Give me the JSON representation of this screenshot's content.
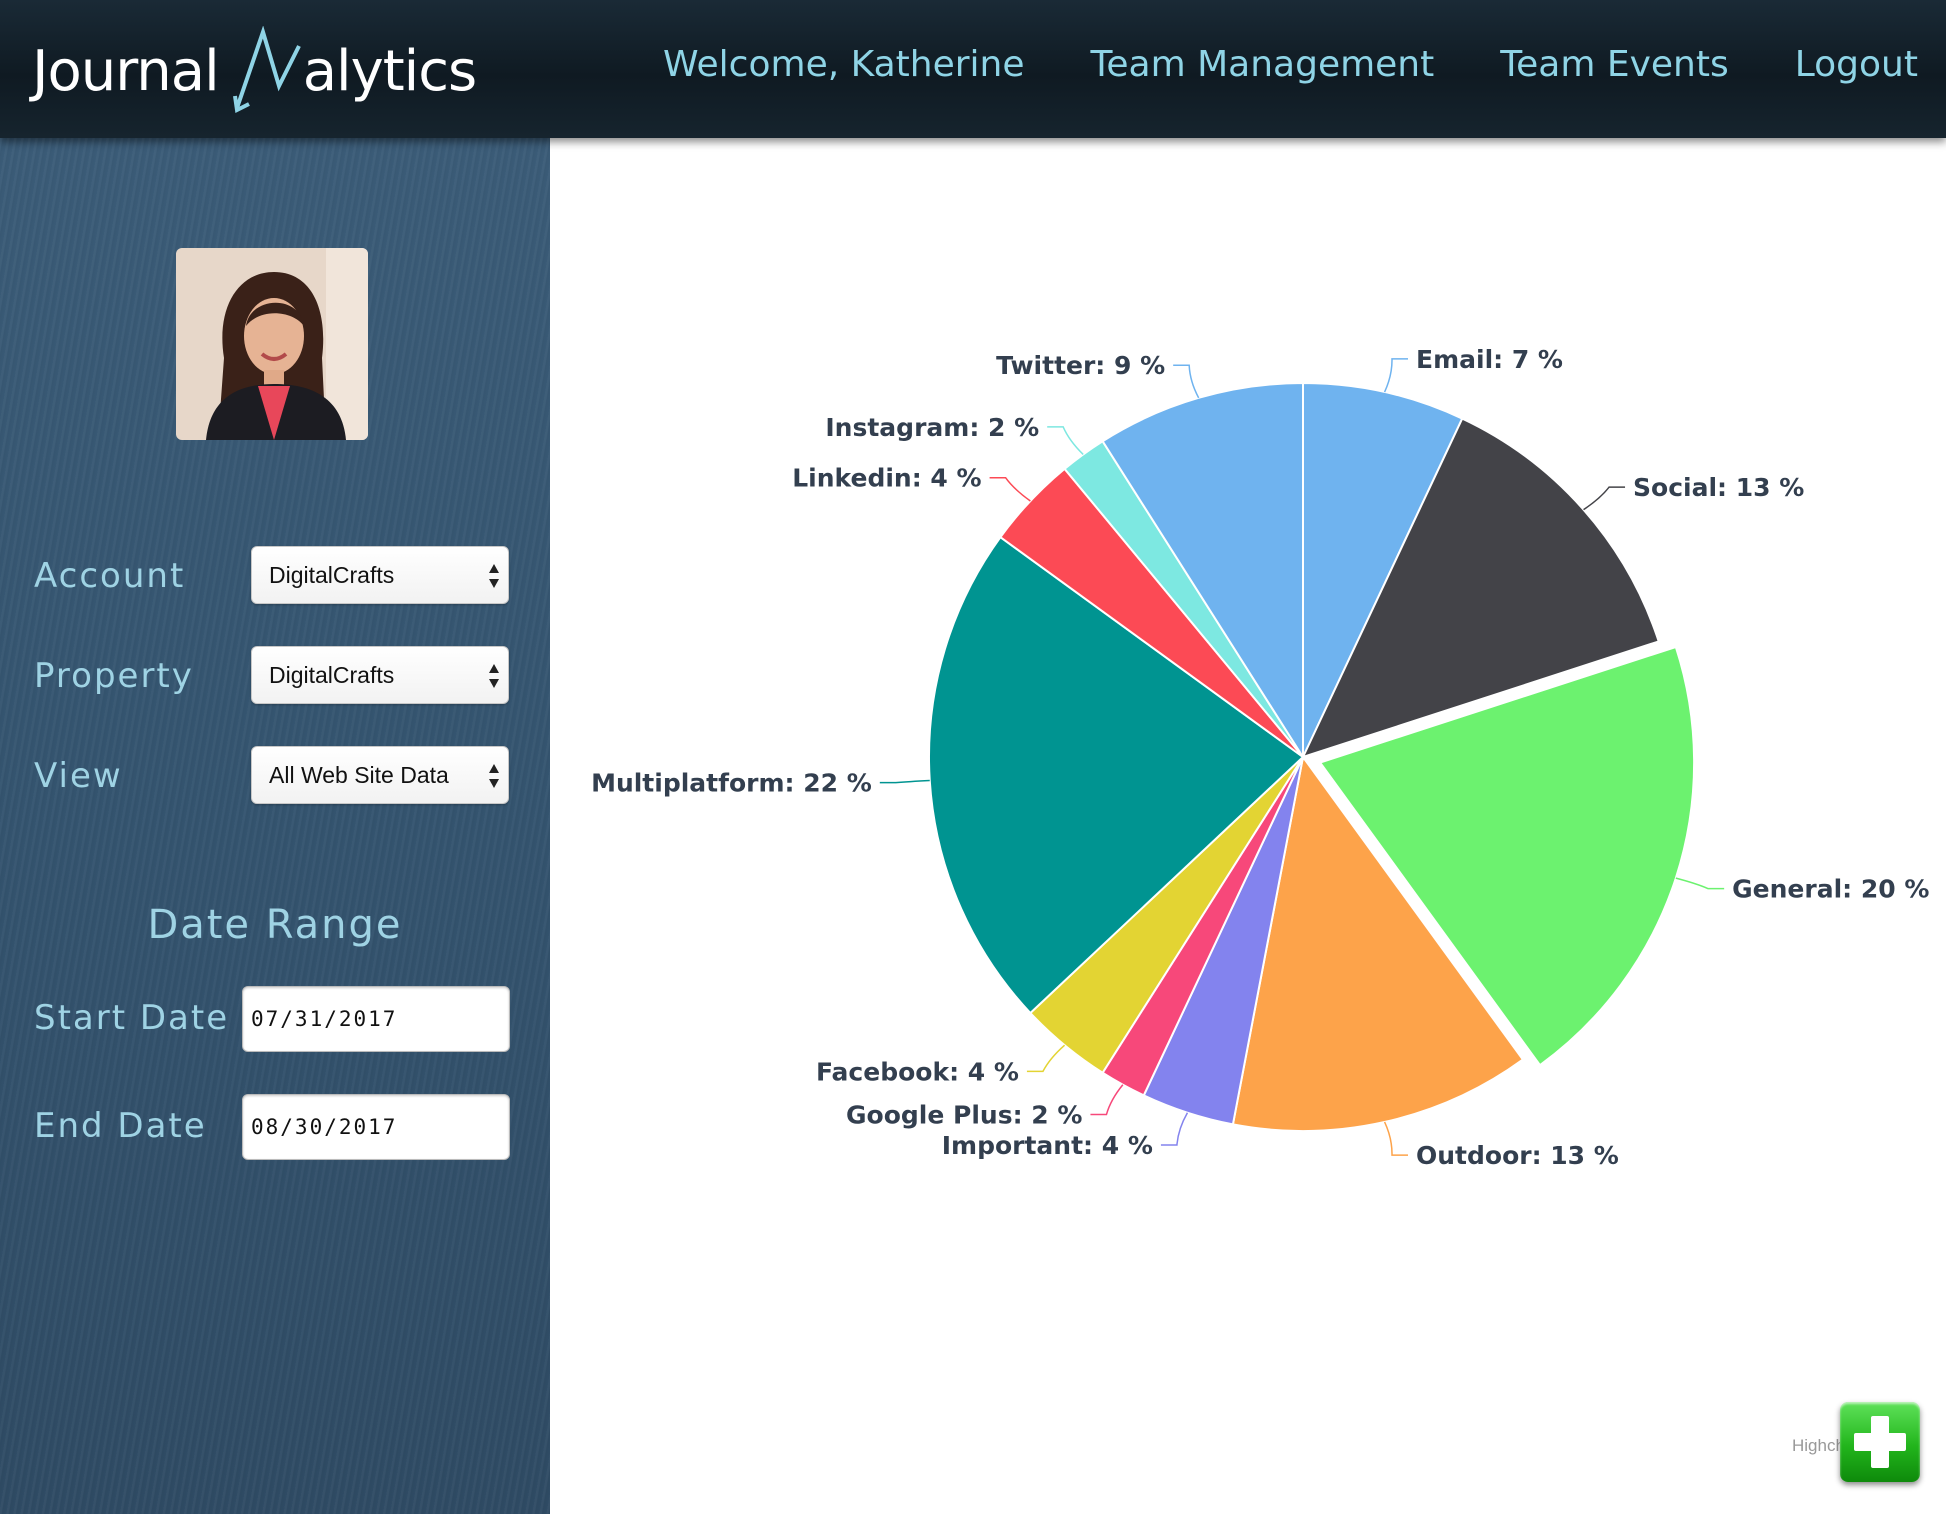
{
  "header": {
    "logo_left": "Journal",
    "logo_right": "alytics",
    "nav": [
      "Welcome, Katherine",
      "Team Management",
      "Team Events",
      "Logout"
    ]
  },
  "sidebar": {
    "fields": [
      {
        "label": "Account",
        "value": "DigitalCrafts"
      },
      {
        "label": "Property",
        "value": "DigitalCrafts"
      },
      {
        "label": "View",
        "value": "All Web Site Data"
      }
    ],
    "date_range": {
      "title": "Date Range",
      "start_label": "Start Date",
      "start_value": "07/31/2017",
      "end_label": "End Date",
      "end_value": "08/30/2017"
    }
  },
  "credits": "Highcharts.com",
  "colors": {
    "nav_text": "#8fd4e6",
    "sidebar_text": "#9fd3e4",
    "label_text": "#333f4f",
    "add_button": "#22b51c"
  },
  "chart_data": {
    "type": "pie",
    "unit": "%",
    "start_category": "Email",
    "sliced": "General",
    "slices": [
      {
        "name": "Email",
        "value": 7,
        "color": "#6fb3ef"
      },
      {
        "name": "Social",
        "value": 13,
        "color": "#434348"
      },
      {
        "name": "General",
        "value": 20,
        "color": "#6cf26f"
      },
      {
        "name": "Outdoor",
        "value": 13,
        "color": "#fda34a"
      },
      {
        "name": "Important",
        "value": 4,
        "color": "#8383ee"
      },
      {
        "name": "Google Plus",
        "value": 2,
        "color": "#f7487a"
      },
      {
        "name": "Facebook",
        "value": 4,
        "color": "#e3d433"
      },
      {
        "name": "Multiplatform",
        "value": 22,
        "color": "#009491"
      },
      {
        "name": "Linkedin",
        "value": 4,
        "color": "#fc4a55"
      },
      {
        "name": "Instagram",
        "value": 2,
        "color": "#7de8e1"
      },
      {
        "name": "Twitter",
        "value": 9,
        "color": "#6fb3ef"
      }
    ]
  }
}
